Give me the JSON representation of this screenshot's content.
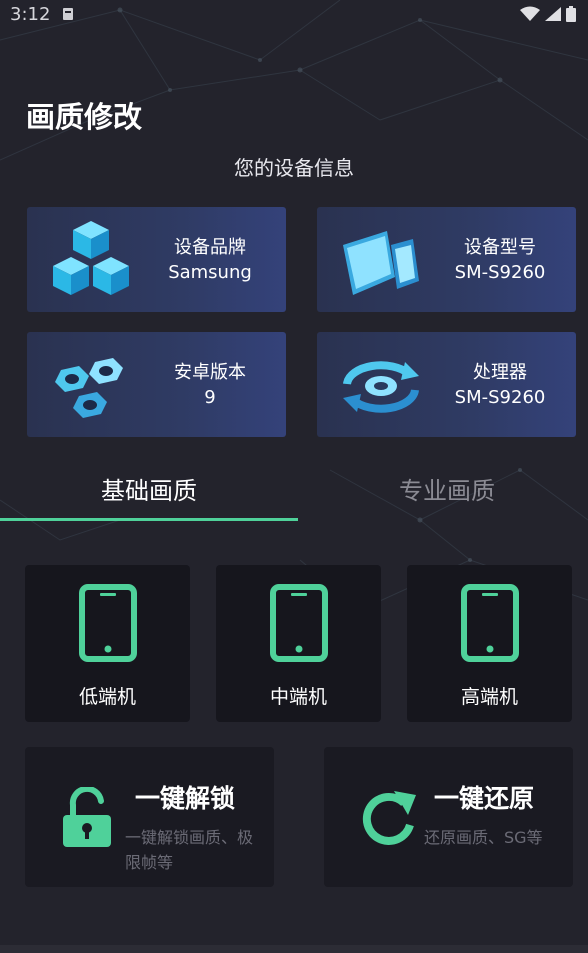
{
  "status_bar": {
    "time": "3:12"
  },
  "page": {
    "title": "画质修改",
    "section_title": "您的设备信息"
  },
  "device_info": [
    {
      "label": "设备品牌",
      "value": "Samsung",
      "icon": "cubes-icon"
    },
    {
      "label": "设备型号",
      "value": "SM-S9260",
      "icon": "devices-icon"
    },
    {
      "label": "安卓版本",
      "value": "9",
      "icon": "nuts-icon"
    },
    {
      "label": "处理器",
      "value": "SM-S9260",
      "icon": "refresh-chip-icon"
    }
  ],
  "tabs": [
    {
      "label": "基础画质",
      "active": true
    },
    {
      "label": "专业画质",
      "active": false
    }
  ],
  "presets": [
    {
      "label": "低端机",
      "icon": "phone-icon"
    },
    {
      "label": "中端机",
      "icon": "phone-icon"
    },
    {
      "label": "高端机",
      "icon": "phone-icon"
    }
  ],
  "actions": [
    {
      "title": "一键解锁",
      "desc": "一键解锁画质、极限帧等",
      "icon": "unlock-icon"
    },
    {
      "title": "一键还原",
      "desc": "还原画质、SG等",
      "icon": "restore-icon"
    }
  ],
  "colors": {
    "background": "#23232c",
    "accent": "#4fd19a",
    "card_blue": "#2f3b64",
    "card_dark": "#16161d",
    "inactive_text": "#8b8b94",
    "desc_text": "#6b6b76"
  }
}
